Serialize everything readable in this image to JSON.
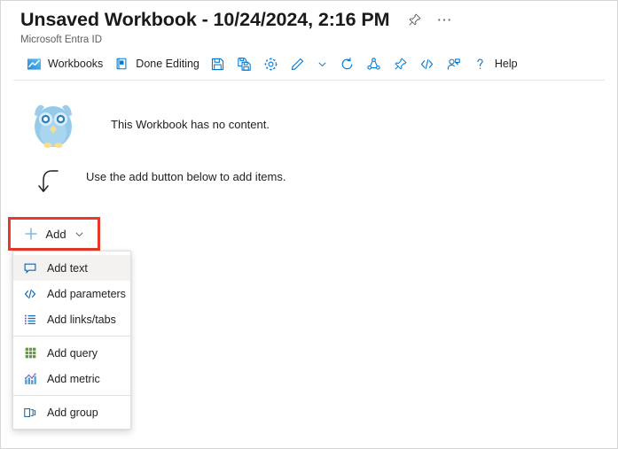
{
  "header": {
    "title": "Unsaved Workbook - 10/24/2024, 2:16 PM",
    "subtitle": "Microsoft Entra ID",
    "pin_icon": "pin-icon",
    "more_icon": "ellipsis-icon"
  },
  "toolbar": {
    "items": [
      {
        "label": "Workbooks",
        "icon": "workbooks-chart-icon",
        "has_label": true
      },
      {
        "label": "Done Editing",
        "icon": "done-editing-icon",
        "has_label": true
      },
      {
        "label": "",
        "icon": "save-icon",
        "has_label": false
      },
      {
        "label": "",
        "icon": "save-as-icon",
        "has_label": false
      },
      {
        "label": "",
        "icon": "gear-icon",
        "has_label": false
      },
      {
        "label": "",
        "icon": "edit-pencil-icon",
        "has_label": false
      },
      {
        "label": "",
        "icon": "chevron-down-icon",
        "has_label": false
      },
      {
        "label": "",
        "icon": "refresh-icon",
        "has_label": false
      },
      {
        "label": "",
        "icon": "share-icon",
        "has_label": false
      },
      {
        "label": "",
        "icon": "pin-icon",
        "has_label": false
      },
      {
        "label": "",
        "icon": "code-brackets-icon",
        "has_label": false
      },
      {
        "label": "",
        "icon": "add-user-icon",
        "has_label": false
      },
      {
        "label": "Help",
        "icon": "question-mark-icon",
        "has_label": true
      }
    ]
  },
  "content": {
    "owl_icon": "owl-illustration",
    "empty_message": "This Workbook has no content.",
    "hint_arrow_icon": "curved-down-arrow-icon",
    "hint_message": "Use the add button below to add items."
  },
  "add_button": {
    "label": "Add",
    "plus_icon": "plus-icon",
    "chevron_icon": "chevron-down-icon",
    "highlight_color": "#e8392b"
  },
  "menu": {
    "groups": [
      {
        "items": [
          {
            "label": "Add text",
            "icon": "text-comment-icon",
            "hovered": true
          },
          {
            "label": "Add parameters",
            "icon": "code-brackets-icon",
            "hovered": false
          },
          {
            "label": "Add links/tabs",
            "icon": "links-tabs-list-icon",
            "hovered": false
          }
        ]
      },
      {
        "items": [
          {
            "label": "Add query",
            "icon": "query-grid-icon",
            "hovered": false
          },
          {
            "label": "Add metric",
            "icon": "metric-chart-icon",
            "hovered": false
          }
        ]
      },
      {
        "items": [
          {
            "label": "Add group",
            "icon": "group-panels-icon",
            "hovered": false
          }
        ]
      }
    ]
  },
  "colors": {
    "accent_blue": "#0078d4",
    "text_primary": "#201f1e",
    "text_secondary": "#605e5c",
    "highlight_red": "#e8392b",
    "menu_hover": "#f3f2f1"
  }
}
